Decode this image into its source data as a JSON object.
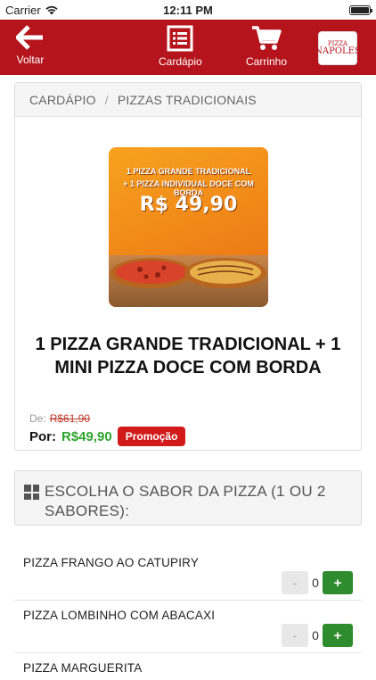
{
  "status": {
    "carrier": "Carrier",
    "time": "12:11 PM"
  },
  "nav": {
    "back_label": "Voltar",
    "menu_label": "Cardápio",
    "cart_label": "Carrinho",
    "logo_line1": "PIZZA",
    "logo_line2": "NAPOLES",
    "color": "#b5141c"
  },
  "breadcrumb": {
    "first": "CARDÁPIO",
    "separator": "/",
    "second": "PIZZAS TRADICIONAIS"
  },
  "product": {
    "image_line1": "1 PIZZA GRANDE TRADICIONAL",
    "image_line2": "+ 1 PIZZA INDIVIDUAL DOCE COM BORDA",
    "image_price": "R$ 49,90",
    "title": "1 PIZZA GRANDE TRADICIONAL + 1 MINI PIZZA DOCE COM BORDA",
    "old_prefix": "De:",
    "old_price": "R$61,90",
    "now_prefix": "Por:",
    "now_price": "R$49,90",
    "badge": "Promoção"
  },
  "flavor_section": {
    "icon": "grid-icon",
    "title": "ESCOLHA O SABOR DA PIZZA (1 OU 2 SABORES):"
  },
  "flavors": [
    {
      "name": "PIZZA FRANGO AO CATUPIRY",
      "qty": "0",
      "minus": "-",
      "plus": "+"
    },
    {
      "name": "PIZZA LOMBINHO COM ABACAXI",
      "qty": "0",
      "minus": "-",
      "plus": "+"
    },
    {
      "name": "PIZZA MARGUERITA"
    }
  ]
}
